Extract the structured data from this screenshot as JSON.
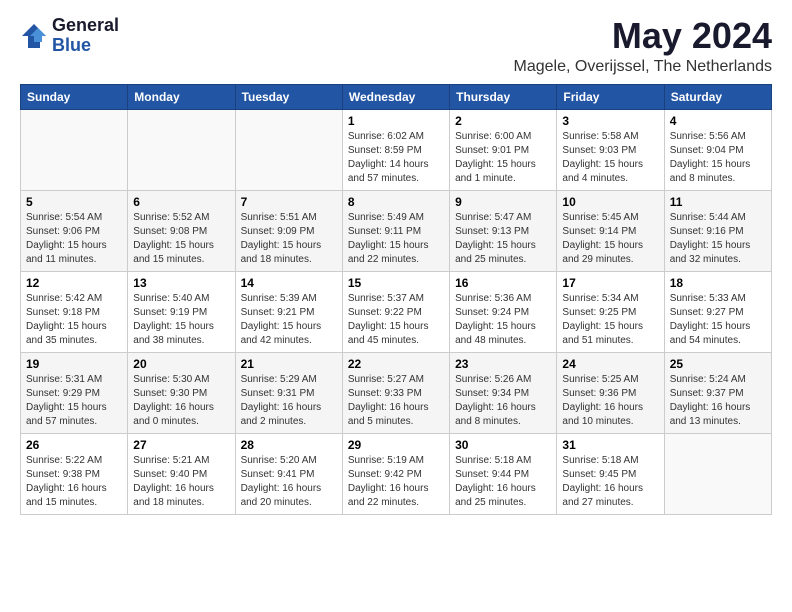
{
  "logo": {
    "general": "General",
    "blue": "Blue"
  },
  "title": "May 2024",
  "subtitle": "Magele, Overijssel, The Netherlands",
  "days_of_week": [
    "Sunday",
    "Monday",
    "Tuesday",
    "Wednesday",
    "Thursday",
    "Friday",
    "Saturday"
  ],
  "weeks": [
    [
      {
        "day": "",
        "info": ""
      },
      {
        "day": "",
        "info": ""
      },
      {
        "day": "",
        "info": ""
      },
      {
        "day": "1",
        "info": "Sunrise: 6:02 AM\nSunset: 8:59 PM\nDaylight: 14 hours\nand 57 minutes."
      },
      {
        "day": "2",
        "info": "Sunrise: 6:00 AM\nSunset: 9:01 PM\nDaylight: 15 hours\nand 1 minute."
      },
      {
        "day": "3",
        "info": "Sunrise: 5:58 AM\nSunset: 9:03 PM\nDaylight: 15 hours\nand 4 minutes."
      },
      {
        "day": "4",
        "info": "Sunrise: 5:56 AM\nSunset: 9:04 PM\nDaylight: 15 hours\nand 8 minutes."
      }
    ],
    [
      {
        "day": "5",
        "info": "Sunrise: 5:54 AM\nSunset: 9:06 PM\nDaylight: 15 hours\nand 11 minutes."
      },
      {
        "day": "6",
        "info": "Sunrise: 5:52 AM\nSunset: 9:08 PM\nDaylight: 15 hours\nand 15 minutes."
      },
      {
        "day": "7",
        "info": "Sunrise: 5:51 AM\nSunset: 9:09 PM\nDaylight: 15 hours\nand 18 minutes."
      },
      {
        "day": "8",
        "info": "Sunrise: 5:49 AM\nSunset: 9:11 PM\nDaylight: 15 hours\nand 22 minutes."
      },
      {
        "day": "9",
        "info": "Sunrise: 5:47 AM\nSunset: 9:13 PM\nDaylight: 15 hours\nand 25 minutes."
      },
      {
        "day": "10",
        "info": "Sunrise: 5:45 AM\nSunset: 9:14 PM\nDaylight: 15 hours\nand 29 minutes."
      },
      {
        "day": "11",
        "info": "Sunrise: 5:44 AM\nSunset: 9:16 PM\nDaylight: 15 hours\nand 32 minutes."
      }
    ],
    [
      {
        "day": "12",
        "info": "Sunrise: 5:42 AM\nSunset: 9:18 PM\nDaylight: 15 hours\nand 35 minutes."
      },
      {
        "day": "13",
        "info": "Sunrise: 5:40 AM\nSunset: 9:19 PM\nDaylight: 15 hours\nand 38 minutes."
      },
      {
        "day": "14",
        "info": "Sunrise: 5:39 AM\nSunset: 9:21 PM\nDaylight: 15 hours\nand 42 minutes."
      },
      {
        "day": "15",
        "info": "Sunrise: 5:37 AM\nSunset: 9:22 PM\nDaylight: 15 hours\nand 45 minutes."
      },
      {
        "day": "16",
        "info": "Sunrise: 5:36 AM\nSunset: 9:24 PM\nDaylight: 15 hours\nand 48 minutes."
      },
      {
        "day": "17",
        "info": "Sunrise: 5:34 AM\nSunset: 9:25 PM\nDaylight: 15 hours\nand 51 minutes."
      },
      {
        "day": "18",
        "info": "Sunrise: 5:33 AM\nSunset: 9:27 PM\nDaylight: 15 hours\nand 54 minutes."
      }
    ],
    [
      {
        "day": "19",
        "info": "Sunrise: 5:31 AM\nSunset: 9:29 PM\nDaylight: 15 hours\nand 57 minutes."
      },
      {
        "day": "20",
        "info": "Sunrise: 5:30 AM\nSunset: 9:30 PM\nDaylight: 16 hours\nand 0 minutes."
      },
      {
        "day": "21",
        "info": "Sunrise: 5:29 AM\nSunset: 9:31 PM\nDaylight: 16 hours\nand 2 minutes."
      },
      {
        "day": "22",
        "info": "Sunrise: 5:27 AM\nSunset: 9:33 PM\nDaylight: 16 hours\nand 5 minutes."
      },
      {
        "day": "23",
        "info": "Sunrise: 5:26 AM\nSunset: 9:34 PM\nDaylight: 16 hours\nand 8 minutes."
      },
      {
        "day": "24",
        "info": "Sunrise: 5:25 AM\nSunset: 9:36 PM\nDaylight: 16 hours\nand 10 minutes."
      },
      {
        "day": "25",
        "info": "Sunrise: 5:24 AM\nSunset: 9:37 PM\nDaylight: 16 hours\nand 13 minutes."
      }
    ],
    [
      {
        "day": "26",
        "info": "Sunrise: 5:22 AM\nSunset: 9:38 PM\nDaylight: 16 hours\nand 15 minutes."
      },
      {
        "day": "27",
        "info": "Sunrise: 5:21 AM\nSunset: 9:40 PM\nDaylight: 16 hours\nand 18 minutes."
      },
      {
        "day": "28",
        "info": "Sunrise: 5:20 AM\nSunset: 9:41 PM\nDaylight: 16 hours\nand 20 minutes."
      },
      {
        "day": "29",
        "info": "Sunrise: 5:19 AM\nSunset: 9:42 PM\nDaylight: 16 hours\nand 22 minutes."
      },
      {
        "day": "30",
        "info": "Sunrise: 5:18 AM\nSunset: 9:44 PM\nDaylight: 16 hours\nand 25 minutes."
      },
      {
        "day": "31",
        "info": "Sunrise: 5:18 AM\nSunset: 9:45 PM\nDaylight: 16 hours\nand 27 minutes."
      },
      {
        "day": "",
        "info": ""
      }
    ]
  ]
}
